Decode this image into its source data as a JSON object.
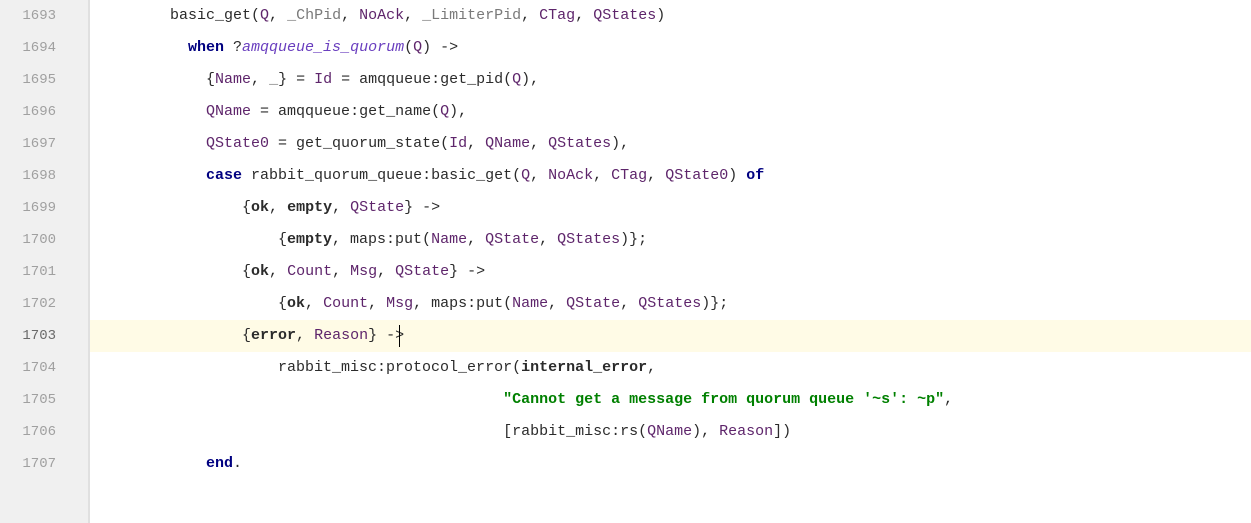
{
  "line_numbers": [
    "1693",
    "1694",
    "1695",
    "1696",
    "1697",
    "1698",
    "1699",
    "1700",
    "1701",
    "1702",
    "1703",
    "1704",
    "1705",
    "1706",
    "1707"
  ],
  "current_line_index": 10,
  "fold_line_index": 14,
  "tokens": {
    "l0": {
      "i": "        ",
      "a": "basic_get(",
      "v1": "Q",
      "c1": ", ",
      "v2": "_ChPid",
      "c2": ", ",
      "v3": "NoAck",
      "c3": ", ",
      "v4": "_LimiterPid",
      "c4": ", ",
      "v5": "CTag",
      "c5": ", ",
      "v6": "QStates",
      "b": ")"
    },
    "l1": {
      "i": "          ",
      "kw": "when",
      "sp": " ?",
      "macro": "amqqueue_is_quorum",
      "a": "(",
      "v": "Q",
      "b": ") ->"
    },
    "l2": {
      "i": "            {",
      "v1": "Name",
      "c1": ", ",
      "v2": "_",
      "c2": "} = ",
      "v3": "Id",
      "c3": " = amqqueue:get_pid(",
      "v4": "Q",
      "c4": "),"
    },
    "l3": {
      "i": "            ",
      "v1": "QName",
      "a": " = amqqueue:get_name(",
      "v2": "Q",
      "b": "),"
    },
    "l4": {
      "i": "            ",
      "v1": "QState0",
      "a": " = get_quorum_state(",
      "v2": "Id",
      "c1": ", ",
      "v3": "QName",
      "c2": ", ",
      "v4": "QStates",
      "b": "),"
    },
    "l5": {
      "i": "            ",
      "kw1": "case",
      "a": " rabbit_quorum_queue:basic_get(",
      "v1": "Q",
      "c1": ", ",
      "v2": "NoAck",
      "c2": ", ",
      "v3": "CTag",
      "c3": ", ",
      "v4": "QState0",
      "b": ") ",
      "kw2": "of"
    },
    "l6": {
      "i": "                {",
      "atom1": "ok",
      "c1": ", ",
      "atom2": "empty",
      "c2": ", ",
      "v1": "QState",
      "b": "} ->"
    },
    "l7": {
      "i": "                    {",
      "atom1": "empty",
      "c1": ", maps:put(",
      "v1": "Name",
      "c2": ", ",
      "v2": "QState",
      "c3": ", ",
      "v3": "QStates",
      "b": ")};"
    },
    "l8": {
      "i": "                {",
      "atom1": "ok",
      "c1": ", ",
      "v1": "Count",
      "c2": ", ",
      "v2": "Msg",
      "c3": ", ",
      "v3": "QState",
      "b": "} ->"
    },
    "l9": {
      "i": "                    {",
      "atom1": "ok",
      "c1": ", ",
      "v1": "Count",
      "c2": ", ",
      "v2": "Msg",
      "c3": ", maps:put(",
      "v3": "Name",
      "c4": ", ",
      "v4": "QState",
      "c5": ", ",
      "v5": "QStates",
      "b": ")};"
    },
    "l10": {
      "i": "                {",
      "atom1": "error",
      "c1": ", ",
      "v1": "Reason",
      "b": "} ->"
    },
    "l11": {
      "i": "                    rabbit_misc:protocol_error(",
      "atom1": "internal_error",
      "b": ","
    },
    "l12": {
      "i": "                                             ",
      "str": "\"Cannot get a message from quorum queue '~s': ~p\"",
      "b": ","
    },
    "l13": {
      "i": "                                             [rabbit_misc:rs(",
      "v1": "QName",
      "c1": "), ",
      "v2": "Reason",
      "b": "])"
    },
    "l14": {
      "i": "            ",
      "kw": "end",
      "b": "."
    }
  }
}
